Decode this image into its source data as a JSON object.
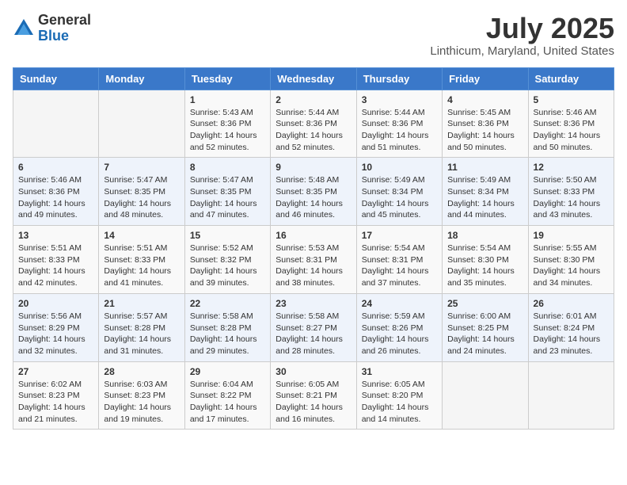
{
  "header": {
    "logo_general": "General",
    "logo_blue": "Blue",
    "main_title": "July 2025",
    "subtitle": "Linthicum, Maryland, United States"
  },
  "days_of_week": [
    "Sunday",
    "Monday",
    "Tuesday",
    "Wednesday",
    "Thursday",
    "Friday",
    "Saturday"
  ],
  "weeks": [
    [
      {
        "day": "",
        "info": ""
      },
      {
        "day": "",
        "info": ""
      },
      {
        "day": "1",
        "info": "Sunrise: 5:43 AM\nSunset: 8:36 PM\nDaylight: 14 hours and 52 minutes."
      },
      {
        "day": "2",
        "info": "Sunrise: 5:44 AM\nSunset: 8:36 PM\nDaylight: 14 hours and 52 minutes."
      },
      {
        "day": "3",
        "info": "Sunrise: 5:44 AM\nSunset: 8:36 PM\nDaylight: 14 hours and 51 minutes."
      },
      {
        "day": "4",
        "info": "Sunrise: 5:45 AM\nSunset: 8:36 PM\nDaylight: 14 hours and 50 minutes."
      },
      {
        "day": "5",
        "info": "Sunrise: 5:46 AM\nSunset: 8:36 PM\nDaylight: 14 hours and 50 minutes."
      }
    ],
    [
      {
        "day": "6",
        "info": "Sunrise: 5:46 AM\nSunset: 8:36 PM\nDaylight: 14 hours and 49 minutes."
      },
      {
        "day": "7",
        "info": "Sunrise: 5:47 AM\nSunset: 8:35 PM\nDaylight: 14 hours and 48 minutes."
      },
      {
        "day": "8",
        "info": "Sunrise: 5:47 AM\nSunset: 8:35 PM\nDaylight: 14 hours and 47 minutes."
      },
      {
        "day": "9",
        "info": "Sunrise: 5:48 AM\nSunset: 8:35 PM\nDaylight: 14 hours and 46 minutes."
      },
      {
        "day": "10",
        "info": "Sunrise: 5:49 AM\nSunset: 8:34 PM\nDaylight: 14 hours and 45 minutes."
      },
      {
        "day": "11",
        "info": "Sunrise: 5:49 AM\nSunset: 8:34 PM\nDaylight: 14 hours and 44 minutes."
      },
      {
        "day": "12",
        "info": "Sunrise: 5:50 AM\nSunset: 8:33 PM\nDaylight: 14 hours and 43 minutes."
      }
    ],
    [
      {
        "day": "13",
        "info": "Sunrise: 5:51 AM\nSunset: 8:33 PM\nDaylight: 14 hours and 42 minutes."
      },
      {
        "day": "14",
        "info": "Sunrise: 5:51 AM\nSunset: 8:33 PM\nDaylight: 14 hours and 41 minutes."
      },
      {
        "day": "15",
        "info": "Sunrise: 5:52 AM\nSunset: 8:32 PM\nDaylight: 14 hours and 39 minutes."
      },
      {
        "day": "16",
        "info": "Sunrise: 5:53 AM\nSunset: 8:31 PM\nDaylight: 14 hours and 38 minutes."
      },
      {
        "day": "17",
        "info": "Sunrise: 5:54 AM\nSunset: 8:31 PM\nDaylight: 14 hours and 37 minutes."
      },
      {
        "day": "18",
        "info": "Sunrise: 5:54 AM\nSunset: 8:30 PM\nDaylight: 14 hours and 35 minutes."
      },
      {
        "day": "19",
        "info": "Sunrise: 5:55 AM\nSunset: 8:30 PM\nDaylight: 14 hours and 34 minutes."
      }
    ],
    [
      {
        "day": "20",
        "info": "Sunrise: 5:56 AM\nSunset: 8:29 PM\nDaylight: 14 hours and 32 minutes."
      },
      {
        "day": "21",
        "info": "Sunrise: 5:57 AM\nSunset: 8:28 PM\nDaylight: 14 hours and 31 minutes."
      },
      {
        "day": "22",
        "info": "Sunrise: 5:58 AM\nSunset: 8:28 PM\nDaylight: 14 hours and 29 minutes."
      },
      {
        "day": "23",
        "info": "Sunrise: 5:58 AM\nSunset: 8:27 PM\nDaylight: 14 hours and 28 minutes."
      },
      {
        "day": "24",
        "info": "Sunrise: 5:59 AM\nSunset: 8:26 PM\nDaylight: 14 hours and 26 minutes."
      },
      {
        "day": "25",
        "info": "Sunrise: 6:00 AM\nSunset: 8:25 PM\nDaylight: 14 hours and 24 minutes."
      },
      {
        "day": "26",
        "info": "Sunrise: 6:01 AM\nSunset: 8:24 PM\nDaylight: 14 hours and 23 minutes."
      }
    ],
    [
      {
        "day": "27",
        "info": "Sunrise: 6:02 AM\nSunset: 8:23 PM\nDaylight: 14 hours and 21 minutes."
      },
      {
        "day": "28",
        "info": "Sunrise: 6:03 AM\nSunset: 8:23 PM\nDaylight: 14 hours and 19 minutes."
      },
      {
        "day": "29",
        "info": "Sunrise: 6:04 AM\nSunset: 8:22 PM\nDaylight: 14 hours and 17 minutes."
      },
      {
        "day": "30",
        "info": "Sunrise: 6:05 AM\nSunset: 8:21 PM\nDaylight: 14 hours and 16 minutes."
      },
      {
        "day": "31",
        "info": "Sunrise: 6:05 AM\nSunset: 8:20 PM\nDaylight: 14 hours and 14 minutes."
      },
      {
        "day": "",
        "info": ""
      },
      {
        "day": "",
        "info": ""
      }
    ]
  ]
}
